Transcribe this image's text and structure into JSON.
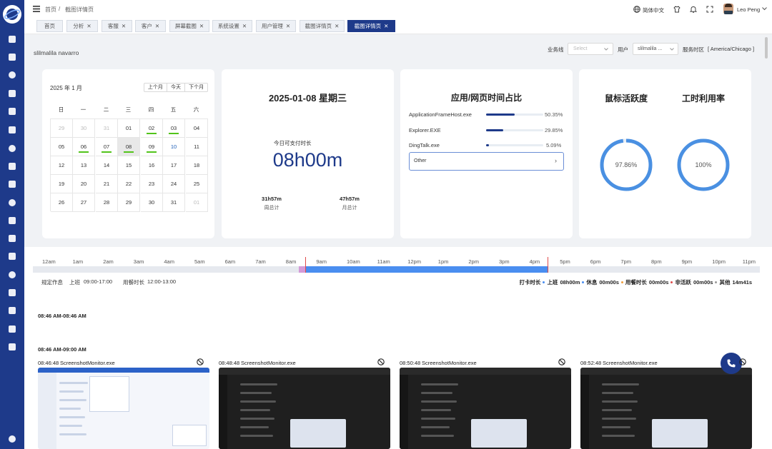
{
  "header": {
    "breadcrumb_home": "首页",
    "breadcrumb_sep": "/",
    "breadcrumb_current": "截图详情页",
    "language": "简体中文",
    "username": "Leo Peng"
  },
  "tabs": [
    {
      "label": "首页"
    },
    {
      "label": "分析"
    },
    {
      "label": "客服"
    },
    {
      "label": "客户"
    },
    {
      "label": "屏幕截图"
    },
    {
      "label": "系统设置"
    },
    {
      "label": "用户管理"
    },
    {
      "label": "截图详情页"
    },
    {
      "label": "截图详情页"
    }
  ],
  "employee_name": "slilmalila navarro",
  "filters": {
    "business_line_label": "业务线",
    "business_line_placeholder": "Select",
    "user_label": "用户",
    "user_value": "slilmalila ...",
    "timezone_label": "服务时区",
    "timezone_value": "[ America/Chicago ]"
  },
  "calendar": {
    "title": "2025 年 1 月",
    "prev": "上个月",
    "today": "今天",
    "next": "下个月",
    "weekdays": [
      "日",
      "一",
      "二",
      "三",
      "四",
      "五",
      "六"
    ],
    "weeks": [
      [
        "29",
        "30",
        "31",
        "01",
        "02",
        "03",
        "04"
      ],
      [
        "05",
        "06",
        "07",
        "08",
        "09",
        "10",
        "11"
      ],
      [
        "12",
        "13",
        "14",
        "15",
        "16",
        "17",
        "18"
      ],
      [
        "19",
        "20",
        "21",
        "22",
        "23",
        "24",
        "25"
      ],
      [
        "26",
        "27",
        "28",
        "29",
        "30",
        "31",
        "01"
      ]
    ]
  },
  "day_summary": {
    "date": "2025-01-08 星期三",
    "payable_label": "今日可支付时长",
    "payable_value": "08h00m",
    "week_value": "31h57m",
    "week_label": "周总计",
    "month_value": "47h57m",
    "month_label": "月总计"
  },
  "app_usage": {
    "title": "应用/网页时间占比",
    "items": [
      {
        "name": "ApplicationFrameHost.exe",
        "percent": "50.35%",
        "fraction": 0.5035
      },
      {
        "name": "Explorer.EXE",
        "percent": "29.85%",
        "fraction": 0.2985
      },
      {
        "name": "DingTalk.exe",
        "percent": "5.09%",
        "fraction": 0.0509
      }
    ],
    "other_label": "Other"
  },
  "gauges": {
    "mouse_title": "鼠标活跃度",
    "mouse_value": "97.86%",
    "mouse_fraction": 0.9786,
    "work_title": "工时利用率",
    "work_value": "100%",
    "work_fraction": 1.0,
    "color": "#4a90e2"
  },
  "timeline": {
    "hours": [
      "12am",
      "1am",
      "2am",
      "3am",
      "4am",
      "5am",
      "6am",
      "7am",
      "8am",
      "9am",
      "10am",
      "11am",
      "12pm",
      "1pm",
      "2pm",
      "3pm",
      "4pm",
      "5pm",
      "6pm",
      "7pm",
      "8pm",
      "9pm",
      "10pm",
      "11pm"
    ],
    "schedule_label": "规定作息",
    "work_label": "上班",
    "work_hours": "09:00-17:00",
    "meal_label": "用餐时长",
    "meal_hours": "12:00-13:00",
    "stats": [
      {
        "label": "打卡时长",
        "value": ""
      },
      {
        "label": "上班",
        "value": "08h00m"
      },
      {
        "label": "休息",
        "value": "00m00s"
      },
      {
        "label": "用餐时长",
        "value": "00m00s"
      },
      {
        "label": "非活跃",
        "value": "00m00s"
      },
      {
        "label": "其他",
        "value": "14m41s"
      }
    ],
    "active_color": "#4a8ef0",
    "pre_color": "#d49ad8"
  },
  "sections": [
    {
      "range": "08:46 AM-08:46 AM"
    },
    {
      "range": "08:46 AM-09:00 AM"
    }
  ],
  "screenshots": [
    {
      "time": "08:46:48",
      "app": "ScreenshotMonitor.exe"
    },
    {
      "time": "08:48:48",
      "app": "ScreenshotMonitor.exe"
    },
    {
      "time": "08:50:48",
      "app": "ScreenshotMonitor.exe"
    },
    {
      "time": "08:52:48",
      "app": "ScreenshotMonitor.exe"
    }
  ]
}
